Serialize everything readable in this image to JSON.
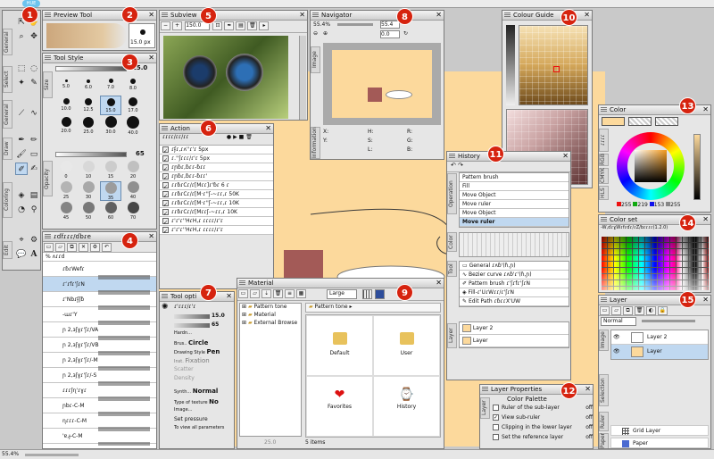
{
  "top_bar": {
    "zoom_badge": "HUE"
  },
  "status_bar": {
    "zoom": "55.4%"
  },
  "badges": [
    "1",
    "2",
    "3",
    "4",
    "5",
    "6",
    "7",
    "8",
    "9",
    "10",
    "11",
    "12",
    "13",
    "14",
    "15"
  ],
  "toolbox": {
    "side_tabs": [
      "General",
      "Select",
      "General",
      "Draw",
      "Coloring",
      "Edit"
    ],
    "text_tool_glyph": "A"
  },
  "preview_tool": {
    "title": "Preview Tool",
    "size": "15.0 px"
  },
  "tool_style": {
    "title": "Tool Style",
    "value": "15.0",
    "side_tabs": [
      "Size",
      "Opacity"
    ],
    "sizes": [
      "5.0",
      "6.0",
      "7.0",
      "8.0",
      "10.0",
      "12.5",
      "15.0",
      "17.0",
      "20.0",
      "25.0",
      "30.0",
      "40.0",
      "50.0",
      "60.0",
      "70.0",
      "80.0"
    ],
    "opacity": "65",
    "opacities": [
      "0",
      "10",
      "15",
      "20",
      "25",
      "30",
      "35",
      "40",
      "45",
      "50",
      "60",
      "70"
    ]
  },
  "brush_panel": {
    "title": "ɾɗfɾɾɾ/ɗbɾe",
    "top_item": "% ʌɾɾd",
    "items": [
      "ɾɓɾWefɾ",
      "ɾʻɾfɾ'ʃɾN",
      "ɾ'Nbɾʄʃɓ",
      "-ɯɾ'Y",
      "ɲ 2,ɜʃɣɾ'ʃɾ/VA",
      "ɲ 2,ɜʃɣɾ'ʃɾ/VB",
      "ɲ 2,ɜʃɣɾ'ʃɾ/-M",
      "ɲ 2,ɜʃɣɾ'ʃɾ/-S",
      "ɾɾɾʃɳ'ɾɣɾ",
      "ɲbɾ-C-M",
      "ɳɾɾɾ-C-M",
      "'ɐ,ɟ-C-M"
    ]
  },
  "subview": {
    "title": "Subview",
    "zoom": "150.0"
  },
  "action": {
    "title": "Action",
    "header": "ɾɾɾɾ/ɾɾ/ɾɾ",
    "items": [
      "ɾʄɾ,ɾʌ''ɾ'ɾ 5px",
      "ɾ.''ʃɾɾɾ/ɾ'ɾ 5px",
      "ɾɲɓɾ,ɓɾɾ-ɓɾɾ",
      "ɾɲɓɾ,ɓɾɾ-ɓɾɾ'",
      "ɾɾɓɾCɾ/ɾ[Mɾɾ]ɾ'ɓɾ 6 ɾ",
      "ɾɾɓɾCɾ/ɾ[M·ɾ''ʃ-~ɾɾ,ɾ 50K",
      "ɾɾɓɾCɾ/ɾ[M·ɾ''ʃ-~ɾɾ,ɾ 10K",
      "ɾɾɓɾCɾ/ɾ[Mɾɾʃ-~ɾɾ,ɾ 10K",
      "ɾ'ɾ'ɾ''HɾH,ɾ ɾɾɾɾ/ɾ'ɾ",
      "ɾ'ɾ'ɾ''HɾH,ɾ ɾɾɾɾ/ɾ'ɾ"
    ]
  },
  "tool_options": {
    "title": "Tool opti",
    "header": "ɾ'ɾɾɾ/ɾ'ɾ",
    "size": "15.0",
    "opacity": "65",
    "rows": [
      {
        "label": "Hardn...",
        "value": ""
      },
      {
        "label": "Brus..",
        "value": "Circle"
      },
      {
        "label": "Drawing Style",
        "value": "Pen"
      },
      {
        "label": "Inst.",
        "value": "Fixation"
      },
      {
        "label": "",
        "value": "Scatter"
      },
      {
        "label": "",
        "value": "Density"
      },
      {
        "label": "Synth...",
        "value": "Normal"
      },
      {
        "label": "Type of texture",
        "value": "No"
      },
      {
        "label": "Image...",
        "value": ""
      },
      {
        "label": "",
        "value": "Set pressure"
      },
      {
        "label": "",
        "value": "To view all parameters"
      }
    ]
  },
  "navigator": {
    "title": "Navigator",
    "zoom_a": "55.4%",
    "zoom_b": "55.4",
    "angle": "0.0",
    "side_tab_image": "Image",
    "side_tab_info": "Information",
    "fields": [
      "X:",
      "Y:",
      "H:",
      "S:",
      "L:",
      "R:",
      "G:",
      "B:"
    ]
  },
  "material": {
    "title": "Material",
    "tree": [
      "Pattern tone",
      "Material",
      "External Browse"
    ],
    "size_option": "Large",
    "path": "Pattern tone",
    "items": [
      {
        "label": "Default"
      },
      {
        "label": "User"
      },
      {
        "label": "Favorites"
      },
      {
        "label": "History"
      }
    ],
    "status": "5 items",
    "zoom": "25.0"
  },
  "colour_guide": {
    "title": "Colour Guide"
  },
  "history": {
    "title": "History",
    "items": [
      "Pattern brush",
      "Fill",
      "Move Object",
      "Move ruler",
      "Move Object",
      "Move ruler"
    ],
    "selected_index": 5,
    "side_tabs": [
      "Operation",
      "Color",
      "Tool",
      "Layer"
    ]
  },
  "tool_list": {
    "items": [
      "General ɾʌɓ'(ɦ,ɲ)",
      "Bezier curve ɾʌɓ'ɾ'(ɦ,ɲ)",
      "Pattern brush ɾ'ʃɾfɾ'ʃɾN",
      "Fill-ɾ'UɾWɾɾ/ɾ'ʃɾN",
      "Edit Path ɾɓɾɾX'UW"
    ]
  },
  "layer_small": {
    "items": [
      {
        "name": "Layer 2"
      },
      {
        "name": "Layer"
      }
    ]
  },
  "color": {
    "title": "Color",
    "side_tabs": [
      "ɾɾɾɾ",
      "RGB",
      "CMYK",
      "HLS"
    ],
    "rgb": [
      "255",
      "219",
      "153",
      "255"
    ]
  },
  "color_set": {
    "title": "Color set",
    "name": "-W,ɗɾɣWɾfɾɗɾ/ɾZ/bɾɾɾɾ(1.2.0)"
  },
  "layer_panel": {
    "title": "Layer",
    "blend": "Normal",
    "side_tabs": [
      "Image",
      "Selection",
      "Ruler",
      "Paper"
    ],
    "layers": [
      {
        "name": "Layer 2"
      },
      {
        "name": "Layer"
      }
    ],
    "grid_layer": "Grid Layer",
    "paper": "Paper"
  },
  "layer_properties": {
    "title": "Layer Properties",
    "header": "Color Palette",
    "side_tab": "Layer",
    "options": [
      {
        "label": "Ruler of the sub-layer",
        "state": "off",
        "checked": false
      },
      {
        "label": "View sub-ruler",
        "state": "off",
        "checked": true
      },
      {
        "label": "Clipping in the lower layer",
        "state": "off",
        "checked": false
      },
      {
        "label": "Set the reference layer",
        "state": "off",
        "checked": false
      }
    ]
  },
  "colors": {
    "badge": "#d6230f",
    "canvas": "#fcd99c",
    "selected": "#c0d8f0"
  }
}
